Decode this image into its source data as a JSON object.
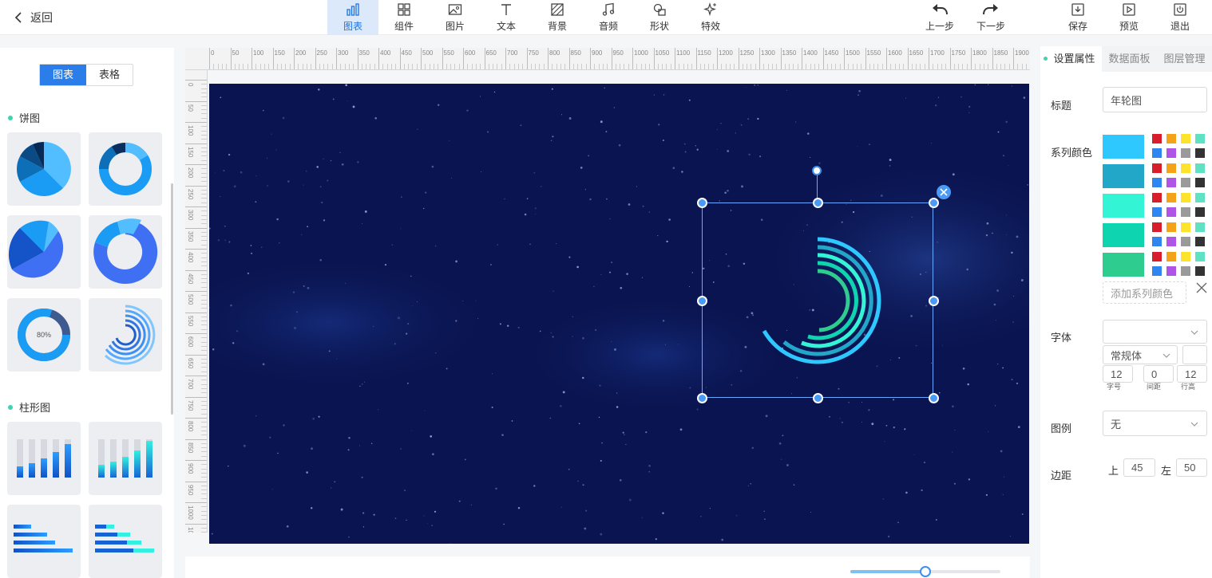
{
  "topbar": {
    "back_label": "返回",
    "tools": [
      {
        "label": "图表",
        "icon": "bar-chart-icon",
        "active": true
      },
      {
        "label": "组件",
        "icon": "grid-icon"
      },
      {
        "label": "图片",
        "icon": "image-icon"
      },
      {
        "label": "文本",
        "icon": "text-icon"
      },
      {
        "label": "背景",
        "icon": "background-icon"
      },
      {
        "label": "音频",
        "icon": "music-icon"
      },
      {
        "label": "形状",
        "icon": "shapes-icon"
      },
      {
        "label": "特效",
        "icon": "sparkle-icon"
      }
    ],
    "undo_label": "上一步",
    "redo_label": "下一步",
    "save_label": "保存",
    "preview_label": "预览",
    "exit_label": "退出"
  },
  "left_panel": {
    "tab_chart": "图表",
    "tab_table": "表格",
    "section_pie": "饼图",
    "section_bar": "柱形图",
    "donut_percent": "80%"
  },
  "ruler": {
    "h_ticks": [
      "0",
      "50",
      "100",
      "150",
      "200",
      "250",
      "300",
      "350",
      "400",
      "450",
      "500",
      "550",
      "600",
      "650",
      "700",
      "750",
      "800",
      "850",
      "900",
      "950",
      "1000",
      "1050",
      "1100",
      "1150",
      "1200",
      "1250",
      "1300",
      "1350",
      "1400",
      "1450",
      "1500",
      "1550",
      "1600",
      "1650",
      "1700",
      "1750",
      "1800",
      "1850",
      "1900",
      "19"
    ],
    "v_ticks": [
      "0",
      "50",
      "100",
      "150",
      "200",
      "250",
      "300",
      "350",
      "400",
      "450",
      "500",
      "550",
      "600",
      "650",
      "700",
      "750",
      "800",
      "850",
      "900",
      "950",
      "1000",
      "1050"
    ]
  },
  "right_panel": {
    "tabs": [
      "设置属性",
      "数据面板",
      "图层管理"
    ],
    "title_label": "标题",
    "title_value": "年轮图",
    "series_color_label": "系列颜色",
    "series_colors": [
      "#2ec8ff",
      "#22a7c8",
      "#33f5d6",
      "#0fd4b0",
      "#2ecc8f"
    ],
    "palette": [
      "#d81e2a",
      "#f5a21b",
      "#fde32c",
      "#5fe2c3",
      "#2f86f1",
      "#b054e8",
      "#9a9a9a",
      "#333333"
    ],
    "add_color_label": "添加系列颜色",
    "font_label": "字体",
    "font_style_value": "常规体",
    "font_size_value": "12",
    "font_size_caption": "字号",
    "spacing_value": "0",
    "spacing_caption": "间距",
    "line_height_value": "12",
    "line_height_caption": "行高",
    "legend_label": "图例",
    "legend_value": "无",
    "margin_label": "边距",
    "margin_top_label": "上",
    "margin_top_value": "45",
    "margin_left_label": "左",
    "margin_left_value": "50"
  },
  "zoom": {
    "level": 0.5
  }
}
